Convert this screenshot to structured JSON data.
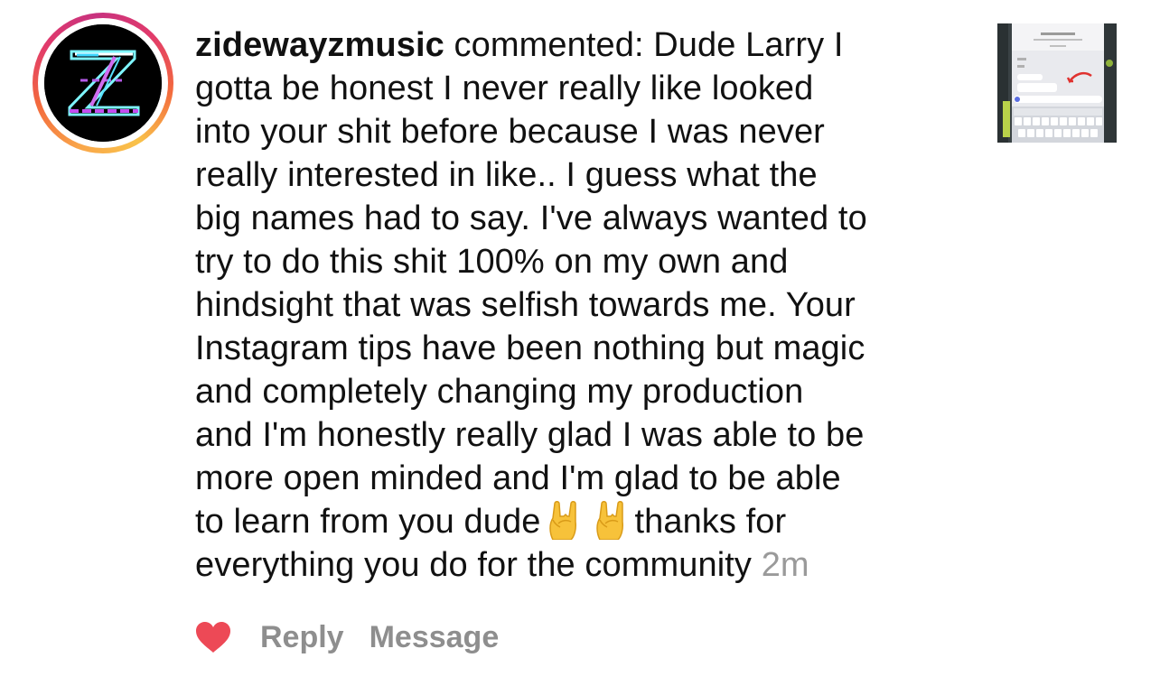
{
  "comment": {
    "username": "zidewayzmusic",
    "lines": [
      " commented: Dude Larry I",
      "gotta be honest I never really like looked",
      "into your shit before because I was never",
      "really interested in like.. I guess what the",
      "big names had to say. I've always wanted to",
      "try to do this shit 100% on my own and",
      "hindsight that was selfish towards me. Your",
      "Instagram tips have been nothing but magic",
      "and completely changing my production",
      "and I'm honestly really glad I was able to be",
      "more open minded and I'm glad to be able"
    ],
    "line12_start": "to learn from you dude",
    "line12_end": "thanks for",
    "line13": "everything you do for the community",
    "timestamp": "2m",
    "emoji": [
      "sign-of-the-horns-emoji",
      "sign-of-the-horns-emoji"
    ]
  },
  "actions": {
    "like_icon": "heart-icon",
    "reply_label": "Reply",
    "message_label": "Message"
  },
  "colors": {
    "text": "#111111",
    "muted": "#8e8e8e",
    "timestamp": "#9a9a9a",
    "heart": "#ed4956",
    "ring_start": "#f9a64a",
    "ring_end": "#c8327f"
  }
}
